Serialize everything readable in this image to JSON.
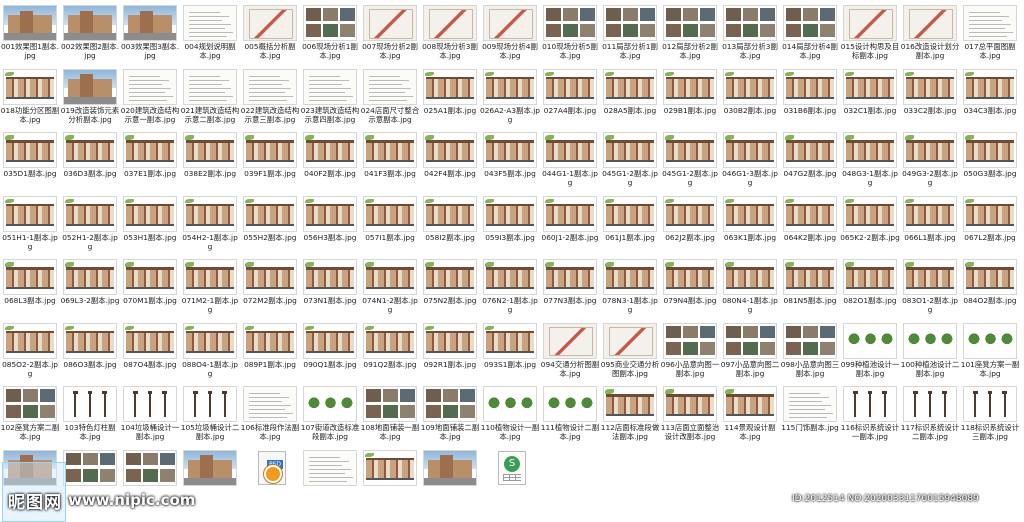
{
  "watermark": {
    "mark": "昵图网",
    "url": "www.nipic.com"
  },
  "id_line": "ID:2012514 NO:20200331170015948089",
  "files": [
    {
      "name": "001效果图1副本.jpg",
      "kind": "photo"
    },
    {
      "name": "002效果图2副本.jpg",
      "kind": "photo"
    },
    {
      "name": "003效果图3副本.jpg",
      "kind": "photo"
    },
    {
      "name": "004规划说明副本.jpg",
      "kind": "doc"
    },
    {
      "name": "005概括分析副本.jpg",
      "kind": "plan"
    },
    {
      "name": "006现场分析1副本.jpg",
      "kind": "photos"
    },
    {
      "name": "007现场分析2副本.jpg",
      "kind": "plan"
    },
    {
      "name": "008现场分析3副本.jpg",
      "kind": "plan"
    },
    {
      "name": "009现场分析4副本.jpg",
      "kind": "plan"
    },
    {
      "name": "010现场分析5副本.jpg",
      "kind": "photos"
    },
    {
      "name": "011局部分析1副本.jpg",
      "kind": "photos"
    },
    {
      "name": "012局部分析2副本.jpg",
      "kind": "photos"
    },
    {
      "name": "013局部分析3副本.jpg",
      "kind": "photos"
    },
    {
      "name": "014局部分析4副本.jpg",
      "kind": "photos"
    },
    {
      "name": "015设计构思及目标副本.jpg",
      "kind": "plan"
    },
    {
      "name": "016改造设计划分副本.jpg",
      "kind": "plan"
    },
    {
      "name": "017总平面图副本.jpg",
      "kind": "doc"
    },
    {
      "name": "018功能分区图副本.jpg",
      "kind": "elev"
    },
    {
      "name": "019改造装饰元素分析副本.jpg",
      "kind": "photo"
    },
    {
      "name": "020建筑改造结构示意一副本.jpg",
      "kind": "doc"
    },
    {
      "name": "021建筑改造结构示意二副本.jpg",
      "kind": "doc"
    },
    {
      "name": "022建筑改造结构示意三副本.jpg",
      "kind": "doc"
    },
    {
      "name": "023建筑改造结构示意四副本.jpg",
      "kind": "doc"
    },
    {
      "name": "024店面尺寸整合示意副本.jpg",
      "kind": "doc"
    },
    {
      "name": "025A1副本.jpg",
      "kind": "elev"
    },
    {
      "name": "026A2-A3副本.jpg",
      "kind": "elev"
    },
    {
      "name": "027A4副本.jpg",
      "kind": "elev"
    },
    {
      "name": "028A5副本.jpg",
      "kind": "elev"
    },
    {
      "name": "029B1副本.jpg",
      "kind": "elev"
    },
    {
      "name": "030B2副本.jpg",
      "kind": "elev"
    },
    {
      "name": "031B6副本.jpg",
      "kind": "elev"
    },
    {
      "name": "032C1副本.jpg",
      "kind": "elev"
    },
    {
      "name": "033C2副本.jpg",
      "kind": "elev"
    },
    {
      "name": "034C3副本.jpg",
      "kind": "elev"
    },
    {
      "name": "035D1副本.jpg",
      "kind": "elev"
    },
    {
      "name": "036D3副本.jpg",
      "kind": "elev"
    },
    {
      "name": "037E1副本.jpg",
      "kind": "elev"
    },
    {
      "name": "038E2副本.jpg",
      "kind": "elev"
    },
    {
      "name": "039F1副本.jpg",
      "kind": "elev"
    },
    {
      "name": "040F2副本.jpg",
      "kind": "elev"
    },
    {
      "name": "041F3副本.jpg",
      "kind": "elev"
    },
    {
      "name": "042F4副本.jpg",
      "kind": "elev"
    },
    {
      "name": "043F5副本.jpg",
      "kind": "elev"
    },
    {
      "name": "044G1-1副本.jpg",
      "kind": "elev"
    },
    {
      "name": "045G1-2副本.jpg",
      "kind": "elev"
    },
    {
      "name": "045G1-2副本.jpg",
      "kind": "elev"
    },
    {
      "name": "046G1-3副本.jpg",
      "kind": "elev"
    },
    {
      "name": "047G2副本.jpg",
      "kind": "elev"
    },
    {
      "name": "048G3-1副本.jpg",
      "kind": "elev"
    },
    {
      "name": "049G3-2副本.jpg",
      "kind": "elev"
    },
    {
      "name": "050G3副本.jpg",
      "kind": "elev"
    },
    {
      "name": "051H1-1副本.jpg",
      "kind": "elev"
    },
    {
      "name": "052H1-2副本.jpg",
      "kind": "elev"
    },
    {
      "name": "053H1副本.jpg",
      "kind": "elev"
    },
    {
      "name": "054H2-1副本.jpg",
      "kind": "elev"
    },
    {
      "name": "055H2副本.jpg",
      "kind": "elev"
    },
    {
      "name": "056H3副本.jpg",
      "kind": "elev"
    },
    {
      "name": "057I1副本.jpg",
      "kind": "elev"
    },
    {
      "name": "058I2副本.jpg",
      "kind": "elev"
    },
    {
      "name": "059I3副本.jpg",
      "kind": "elev"
    },
    {
      "name": "060J1-2副本.jpg",
      "kind": "elev"
    },
    {
      "name": "061J1副本.jpg",
      "kind": "elev"
    },
    {
      "name": "062J2副本.jpg",
      "kind": "elev"
    },
    {
      "name": "063K1副本.jpg",
      "kind": "elev"
    },
    {
      "name": "064K2副本.jpg",
      "kind": "elev"
    },
    {
      "name": "065K2-2副本.jpg",
      "kind": "elev"
    },
    {
      "name": "066L1副本.jpg",
      "kind": "elev"
    },
    {
      "name": "067L2副本.jpg",
      "kind": "elev"
    },
    {
      "name": "068L3副本.jpg",
      "kind": "elev"
    },
    {
      "name": "069L3-2副本.jpg",
      "kind": "elev"
    },
    {
      "name": "070M1副本.jpg",
      "kind": "elev"
    },
    {
      "name": "071M2-1副本.jpg",
      "kind": "elev"
    },
    {
      "name": "072M2副本.jpg",
      "kind": "elev"
    },
    {
      "name": "073N1副本.jpg",
      "kind": "elev"
    },
    {
      "name": "074N1-2副本.jpg",
      "kind": "elev"
    },
    {
      "name": "075N2副本.jpg",
      "kind": "elev"
    },
    {
      "name": "076N2-1副本.jpg",
      "kind": "elev"
    },
    {
      "name": "077N3副本.jpg",
      "kind": "elev"
    },
    {
      "name": "078N3-1副本.jpg",
      "kind": "elev"
    },
    {
      "name": "079N4副本.jpg",
      "kind": "elev"
    },
    {
      "name": "080N4-1副本.jpg",
      "kind": "elev"
    },
    {
      "name": "081N5副本.jpg",
      "kind": "elev"
    },
    {
      "name": "082O1副本.jpg",
      "kind": "elev"
    },
    {
      "name": "083O1-2副本.jpg",
      "kind": "elev"
    },
    {
      "name": "084O2副本.jpg",
      "kind": "elev"
    },
    {
      "name": "085O2-2副本.jpg",
      "kind": "elev"
    },
    {
      "name": "086O3副本.jpg",
      "kind": "elev"
    },
    {
      "name": "087O4副本.jpg",
      "kind": "elev"
    },
    {
      "name": "088O4-1副本.jpg",
      "kind": "elev"
    },
    {
      "name": "089P1副本.jpg",
      "kind": "elev"
    },
    {
      "name": "090Q1副本.jpg",
      "kind": "elev"
    },
    {
      "name": "091Q2副本.jpg",
      "kind": "elev"
    },
    {
      "name": "092R1副本.jpg",
      "kind": "elev"
    },
    {
      "name": "093S1副本.jpg",
      "kind": "elev"
    },
    {
      "name": "094交通分析图副本.jpg",
      "kind": "plan"
    },
    {
      "name": "095商业交通分析图副本.jpg",
      "kind": "plan"
    },
    {
      "name": "096小品意向图一副本.jpg",
      "kind": "photos"
    },
    {
      "name": "097小品意向图二副本.jpg",
      "kind": "photos"
    },
    {
      "name": "098小品意向图三副本.jpg",
      "kind": "photos"
    },
    {
      "name": "099种植池设计一副本.jpg",
      "kind": "veg"
    },
    {
      "name": "100种植池设计二副本.jpg",
      "kind": "veg"
    },
    {
      "name": "101座凳方案一副本.jpg",
      "kind": "veg"
    },
    {
      "name": "102座凳方案二副本.jpg",
      "kind": "photos"
    },
    {
      "name": "103特色灯柱副本.jpg",
      "kind": "post"
    },
    {
      "name": "104垃圾桶设计一副本.jpg",
      "kind": "post"
    },
    {
      "name": "105垃圾桶设计二副本.jpg",
      "kind": "post"
    },
    {
      "name": "106标准段作法副本.jpg",
      "kind": "doc"
    },
    {
      "name": "107街道改造标准段副本.jpg",
      "kind": "veg"
    },
    {
      "name": "108地面铺装一副本.jpg",
      "kind": "photos"
    },
    {
      "name": "109地面铺装二副本.jpg",
      "kind": "photos"
    },
    {
      "name": "110植物设计一副本.jpg",
      "kind": "veg"
    },
    {
      "name": "111植物设计二副本.jpg",
      "kind": "veg"
    },
    {
      "name": "112店面标准段做法副本.jpg",
      "kind": "elev"
    },
    {
      "name": "113店面立面整治设计改副本.jpg",
      "kind": "elev"
    },
    {
      "name": "114景观设计副本.jpg",
      "kind": "elev"
    },
    {
      "name": "115门饰副本.jpg",
      "kind": "doc"
    },
    {
      "name": "116标识系统设计一副本.jpg",
      "kind": "post"
    },
    {
      "name": "117标识系统设计二副本.jpg",
      "kind": "post"
    },
    {
      "name": "118标识系统设计三副本.jpg",
      "kind": "post"
    },
    {
      "name": "",
      "kind": "photo"
    },
    {
      "name": "",
      "kind": "photos"
    },
    {
      "name": "",
      "kind": "photos"
    },
    {
      "name": "",
      "kind": "photo"
    },
    {
      "name": "",
      "kind": "psd"
    },
    {
      "name": "",
      "kind": "doc"
    },
    {
      "name": "",
      "kind": "elev"
    },
    {
      "name": "",
      "kind": "photo"
    },
    {
      "name": "",
      "kind": "xls"
    }
  ]
}
